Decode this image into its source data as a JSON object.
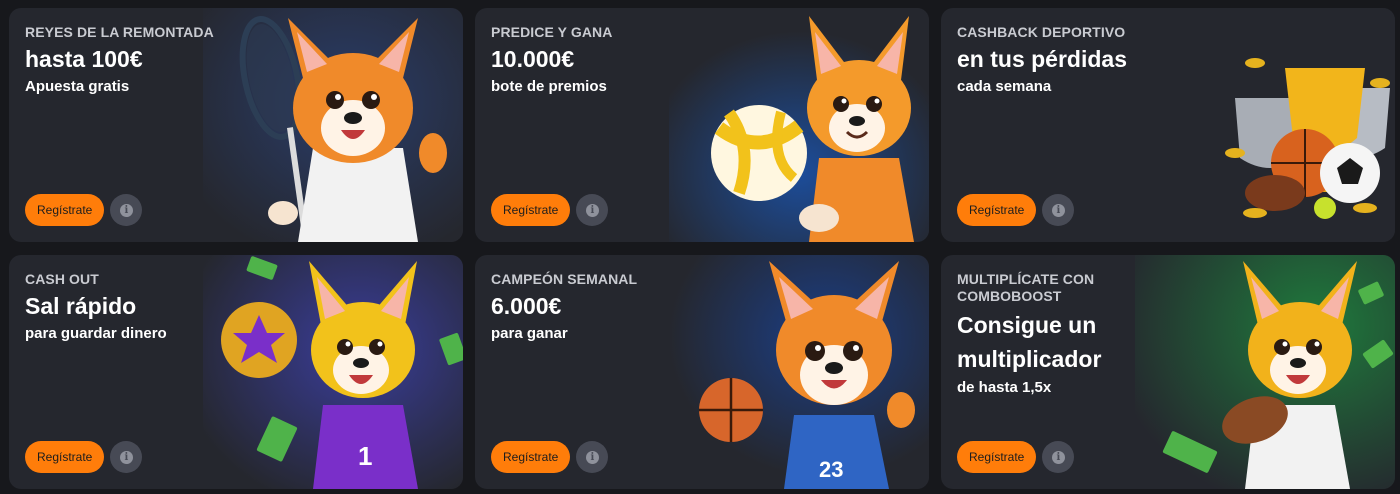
{
  "promos": [
    {
      "eyebrow": "REYES DE LA REMONTADA",
      "headline": "hasta 100€",
      "subline": "Apuesta gratis",
      "cta": "Regístrate",
      "info_icon": "info-icon",
      "art": "corgi-tennis-illustration"
    },
    {
      "eyebrow": "PREDICE Y GANA",
      "headline": "10.000€",
      "subline": "bote de premios",
      "cta": "Regístrate",
      "info_icon": "info-icon",
      "art": "corgi-volleyball-illustration"
    },
    {
      "eyebrow": "CASHBACK DEPORTIVO",
      "headline": "en tus pérdidas",
      "subline": "cada semana",
      "cta": "Regístrate",
      "info_icon": "info-icon",
      "art": "trophy-balls-illustration"
    },
    {
      "eyebrow": "CASH OUT",
      "headline": "Sal rápido",
      "subline": "para guardar dinero",
      "cta": "Regístrate",
      "info_icon": "info-icon",
      "art": "corgi-handball-illustration"
    },
    {
      "eyebrow": "CAMPEÓN SEMANAL",
      "headline": "6.000€",
      "subline": "para ganar",
      "cta": "Regístrate",
      "info_icon": "info-icon",
      "art": "corgi-basketball-illustration"
    },
    {
      "eyebrow": "MULTIPLÍCATE CON COMBOBOOST",
      "headline": "Consigue un multiplicador",
      "subline": "de hasta 1,5x",
      "cta": "Regístrate",
      "info_icon": "info-icon",
      "art": "corgi-rugby-illustration"
    }
  ],
  "colors": {
    "card_bg": "#25272e",
    "page_bg": "#17181c",
    "cta_bg": "#ff7d0a",
    "info_bg": "#474a55"
  },
  "info_glyph": "i"
}
